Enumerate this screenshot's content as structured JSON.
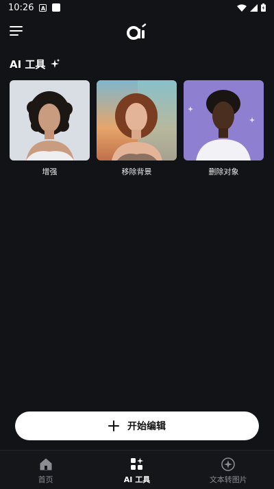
{
  "status_bar": {
    "time": "10:26",
    "notification_letter": "A"
  },
  "section": {
    "title": "AI 工具"
  },
  "tools": [
    {
      "label": "增强"
    },
    {
      "label": "移除背景"
    },
    {
      "label": "删除对象"
    }
  ],
  "primary_action": {
    "label": "开始编辑"
  },
  "bottom_nav": [
    {
      "label": "首页",
      "icon": "home-icon",
      "active": false
    },
    {
      "label": "AI 工具",
      "icon": "ai-tools-icon",
      "active": true
    },
    {
      "label": "文本转图片",
      "icon": "text-to-image-icon",
      "active": false
    }
  ],
  "colors": {
    "background": "#121317",
    "button": "#ffffff",
    "inactive_nav": "#8a8c92"
  }
}
